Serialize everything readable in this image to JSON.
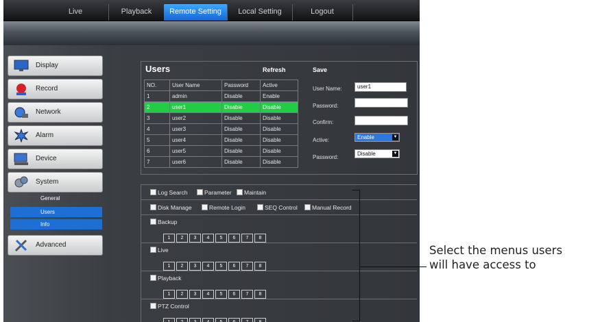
{
  "nav": {
    "tabs": [
      {
        "label": "Live",
        "active": false
      },
      {
        "label": "Playback",
        "active": false
      },
      {
        "label": "Remote Setting",
        "active": true
      },
      {
        "label": "Local Setting",
        "active": false
      },
      {
        "label": "Logout",
        "active": false
      }
    ]
  },
  "sidebar": {
    "items": [
      {
        "label": "Display",
        "icon": "monitor-icon"
      },
      {
        "label": "Record",
        "icon": "record-icon"
      },
      {
        "label": "Network",
        "icon": "network-icon"
      },
      {
        "label": "Alarm",
        "icon": "alarm-icon"
      },
      {
        "label": "Device",
        "icon": "device-icon"
      },
      {
        "label": "System",
        "icon": "system-icon"
      }
    ],
    "system_sub": [
      {
        "label": "General",
        "selected": false
      },
      {
        "label": "Users",
        "selected": true
      },
      {
        "label": "Info",
        "selected": true
      }
    ],
    "advanced": {
      "label": "Advanced",
      "icon": "tools-icon"
    }
  },
  "users": {
    "title": "Users",
    "refresh": "Refresh",
    "save": "Save",
    "headers": [
      "NO.",
      "User Name",
      "Password",
      "Active"
    ],
    "rows": [
      {
        "no": "1",
        "name": "admin",
        "password": "Disable",
        "active": "Enable",
        "selected": false
      },
      {
        "no": "2",
        "name": "user1",
        "password": "Disable",
        "active": "Disable",
        "selected": true
      },
      {
        "no": "3",
        "name": "user2",
        "password": "Disable",
        "active": "Disable",
        "selected": false
      },
      {
        "no": "4",
        "name": "user3",
        "password": "Disable",
        "active": "Disable",
        "selected": false
      },
      {
        "no": "5",
        "name": "user4",
        "password": "Disable",
        "active": "Disable",
        "selected": false
      },
      {
        "no": "6",
        "name": "user5",
        "password": "Disable",
        "active": "Disable",
        "selected": false
      },
      {
        "no": "7",
        "name": "user6",
        "password": "Disable",
        "active": "Disable",
        "selected": false
      }
    ]
  },
  "form": {
    "username_label": "User Name:",
    "username_value": "user1",
    "password_label": "Password:",
    "confirm_label": "Confirm:",
    "active_label": "Active:",
    "active_value": "Enable",
    "password_enable_label": "Password:",
    "password_enable_value": "Disable"
  },
  "permissions": {
    "row1": [
      "Log Search",
      "Parameter",
      "Maintain"
    ],
    "row2": [
      "Disk Manage",
      "Remote Login",
      "SEQ Control",
      "Manual Record"
    ],
    "groups": [
      {
        "label": "Backup"
      },
      {
        "label": "Live"
      },
      {
        "label": "Playback"
      },
      {
        "label": "PTZ Control"
      }
    ],
    "channels": [
      "1",
      "2",
      "3",
      "4",
      "5",
      "6",
      "7",
      "8"
    ]
  },
  "callout": {
    "line1": "Select the menus users",
    "line2": "will have access to"
  },
  "colors": {
    "selected_row": "#22cc44",
    "accent_blue": "#1d6fd6",
    "background": "#2d3035"
  }
}
